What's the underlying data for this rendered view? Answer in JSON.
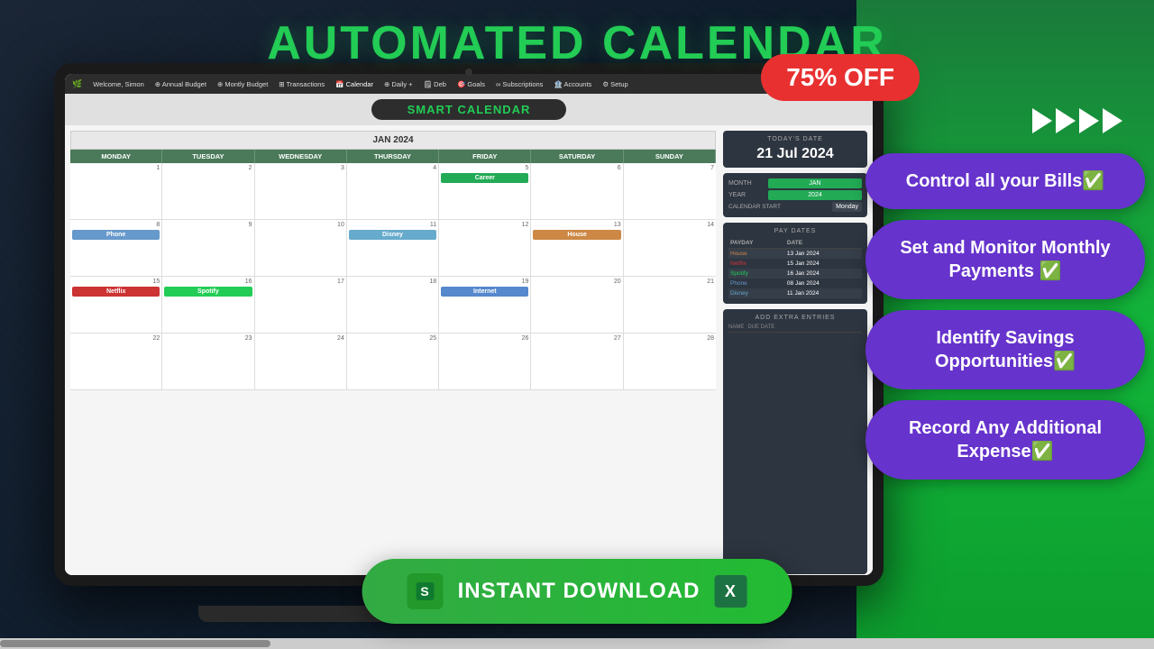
{
  "page": {
    "title": "AUTOMATED CALENDAR",
    "discount": "75% OFF",
    "download_btn": "INSTANT DOWNLOAD"
  },
  "arrows": [
    "▶",
    "▶",
    "▶",
    "▶"
  ],
  "features": [
    {
      "id": "bills",
      "text": "Control all your Bills✅"
    },
    {
      "id": "payments",
      "text": "Set and Monitor Monthly Payments ✅"
    },
    {
      "id": "savings",
      "text": "Identify Savings Opportunities✅"
    },
    {
      "id": "expense",
      "text": "Record Any Additional Expense✅"
    }
  ],
  "nav": {
    "welcome": "Welcome, Simon",
    "items": [
      "Annual Budget",
      "Montly Budget",
      "Transactions",
      "Calendar",
      "Daily +",
      "Deb",
      "Goals",
      "Subscriptions",
      "Accounts",
      "Setup"
    ]
  },
  "calendar": {
    "title": "SMART CALENDAR",
    "month_header": "JAN 2024",
    "day_headers": [
      "MONDAY",
      "TUESDAY",
      "WEDNESDAY",
      "THURSDAY",
      "FRIDAY",
      "SATURDAY",
      "SUNDAY"
    ],
    "weeks": [
      {
        "days": [
          {
            "num": 1,
            "event": null
          },
          {
            "num": 2,
            "event": null
          },
          {
            "num": 3,
            "event": null
          },
          {
            "num": 4,
            "event": null
          },
          {
            "num": 5,
            "event": "Career",
            "class": "event-career"
          },
          {
            "num": 6,
            "event": null
          },
          {
            "num": 7,
            "event": null
          }
        ]
      },
      {
        "days": [
          {
            "num": 8,
            "event": "Phone",
            "class": "event-phone"
          },
          {
            "num": 9,
            "event": null
          },
          {
            "num": 10,
            "event": null
          },
          {
            "num": 11,
            "event": "Disney",
            "class": "event-disney"
          },
          {
            "num": 12,
            "event": null
          },
          {
            "num": 13,
            "event": "House",
            "class": "event-house"
          },
          {
            "num": 14,
            "event": null
          }
        ]
      },
      {
        "days": [
          {
            "num": 15,
            "event": "Netflix",
            "class": "event-netflix"
          },
          {
            "num": 16,
            "event": "Spotify",
            "class": "event-spotify"
          },
          {
            "num": 17,
            "event": null
          },
          {
            "num": 18,
            "event": null
          },
          {
            "num": 19,
            "event": "Internet",
            "class": "event-internet"
          },
          {
            "num": 20,
            "event": null
          },
          {
            "num": 21,
            "event": null
          }
        ]
      },
      {
        "days": [
          {
            "num": 22,
            "event": null
          },
          {
            "num": 23,
            "event": null
          },
          {
            "num": 24,
            "event": null
          },
          {
            "num": 25,
            "event": null
          },
          {
            "num": 26,
            "event": null
          },
          {
            "num": 27,
            "event": null
          },
          {
            "num": 28,
            "event": null
          }
        ]
      }
    ],
    "today_date_label": "TODAY'S DATE",
    "today_date": "21 Jul 2024",
    "month_label": "MONTH",
    "month_val": "JAN",
    "year_label": "YEAR",
    "year_val": "2024",
    "cal_start_label": "CALENDAR START",
    "cal_start_val": "Monday",
    "pay_dates_title": "PAY DATES",
    "pay_dates_headers": [
      "PAYDAY",
      "DATE"
    ],
    "pay_dates": [
      {
        "name": "House",
        "class": "house",
        "date": "13 Jan 2024"
      },
      {
        "name": "Netflix",
        "class": "netflix",
        "date": "15 Jan 2024"
      },
      {
        "name": "Spotify",
        "class": "spotify",
        "date": "16 Jan 2024"
      },
      {
        "name": "Phone",
        "class": "phone",
        "date": "08 Jan 2024"
      },
      {
        "name": "Disney",
        "class": "disney",
        "date": "11 Jan 2024"
      }
    ],
    "add_extra_title": "ADD EXTRA ENTRIES",
    "add_extra_headers": [
      "NAME",
      "DUE DATE"
    ]
  }
}
